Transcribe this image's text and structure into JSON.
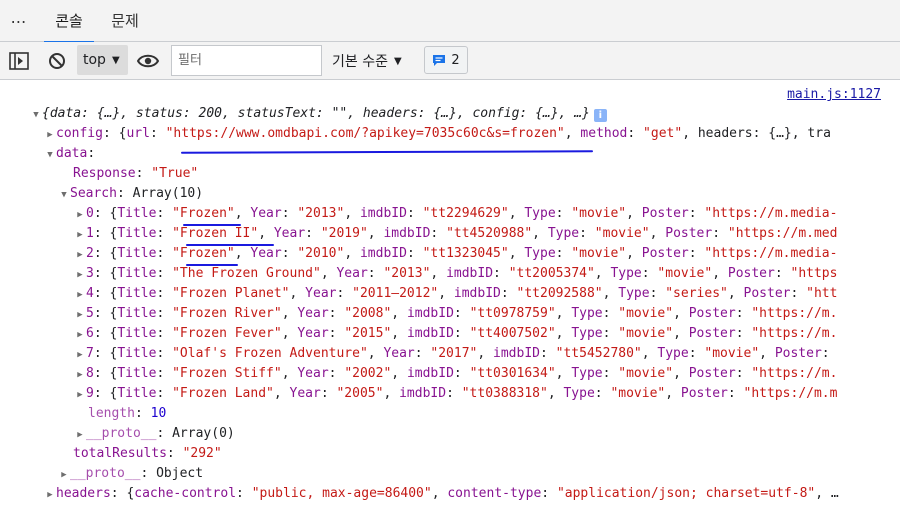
{
  "tabs": [
    {
      "label": "콘솔",
      "active": true
    },
    {
      "label": "문제",
      "active": false
    }
  ],
  "toolbar": {
    "context": "top",
    "filter_placeholder": "필터",
    "levels_label": "기본 수준",
    "message_count": "2"
  },
  "console": {
    "source_link": "main.js:1127",
    "root_summary": "{data: {…}, status: 200, statusText: \"\", headers: {…}, config: {…}, …}",
    "config": {
      "key": "config",
      "url": "\"https://www.omdbapi.com/?apikey=7035c60c&s=frozen\"",
      "method": "\"get\"",
      "tail": "headers: {…}, tra"
    },
    "data_key": "data",
    "response": {
      "key": "Response",
      "value": "\"True\""
    },
    "search_header": {
      "key": "Search",
      "value": "Array(10)"
    },
    "search": [
      {
        "index": "0",
        "title": "\"Frozen\"",
        "year": "\"2013\"",
        "imdb": "\"tt2294629\"",
        "type": "\"movie\"",
        "poster": "\"https://m.media-"
      },
      {
        "index": "1",
        "title": "\"Frozen II\"",
        "year": "\"2019\"",
        "imdb": "\"tt4520988\"",
        "type": "\"movie\"",
        "poster": "\"https://m.med"
      },
      {
        "index": "2",
        "title": "\"Frozen\"",
        "year": "\"2010\"",
        "imdb": "\"tt1323045\"",
        "type": "\"movie\"",
        "poster": "\"https://m.media-"
      },
      {
        "index": "3",
        "title": "\"The Frozen Ground\"",
        "year": "\"2013\"",
        "imdb": "\"tt2005374\"",
        "type": "\"movie\"",
        "poster": "\"https"
      },
      {
        "index": "4",
        "title": "\"Frozen Planet\"",
        "year": "\"2011–2012\"",
        "imdb": "\"tt2092588\"",
        "type": "\"series\"",
        "poster": "\"htt"
      },
      {
        "index": "5",
        "title": "\"Frozen River\"",
        "year": "\"2008\"",
        "imdb": "\"tt0978759\"",
        "type": "\"movie\"",
        "poster": "\"https://m."
      },
      {
        "index": "6",
        "title": "\"Frozen Fever\"",
        "year": "\"2015\"",
        "imdb": "\"tt4007502\"",
        "type": "\"movie\"",
        "poster": "\"https://m."
      },
      {
        "index": "7",
        "title": "\"Olaf's Frozen Adventure\"",
        "year": "\"2017\"",
        "imdb": "\"tt5452780\"",
        "type": "\"movie\"",
        "poster": ""
      },
      {
        "index": "8",
        "title": "\"Frozen Stiff\"",
        "year": "\"2002\"",
        "imdb": "\"tt0301634\"",
        "type": "\"movie\"",
        "poster": "\"https://m."
      },
      {
        "index": "9",
        "title": "\"Frozen Land\"",
        "year": "\"2005\"",
        "imdb": "\"tt0388318\"",
        "type": "\"movie\"",
        "poster": "\"https://m.m"
      }
    ],
    "length": {
      "key": "length",
      "value": "10"
    },
    "array_proto": {
      "key": "__proto__",
      "value": "Array(0)"
    },
    "total_results": {
      "key": "totalResults",
      "value": "\"292\""
    },
    "object_proto": {
      "key": "__proto__",
      "value": "Object"
    },
    "headers": {
      "key": "headers",
      "cache_control": "\"public, max-age=86400\"",
      "content_type": "\"application/json; charset=utf-8\""
    }
  }
}
